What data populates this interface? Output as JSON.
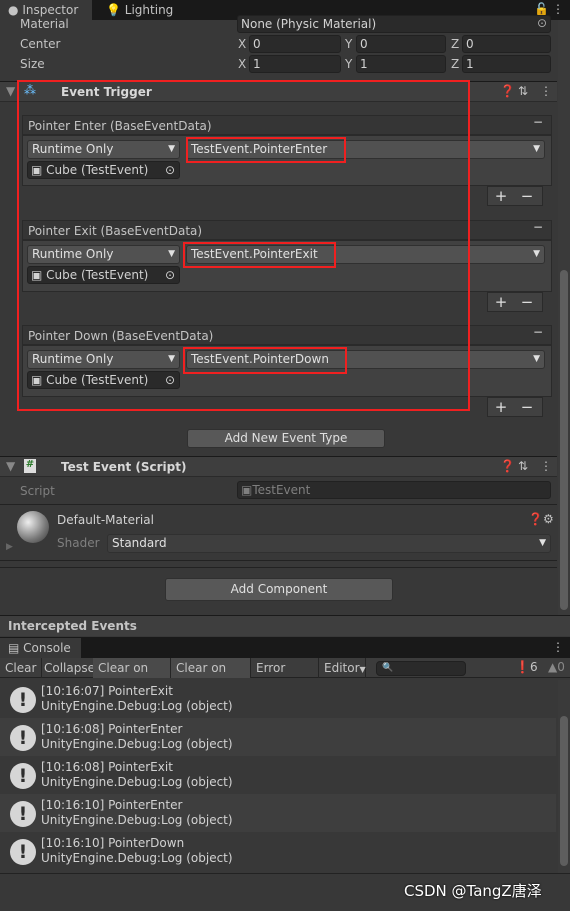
{
  "tabs": {
    "inspector": "Inspector",
    "lighting": "Lighting"
  },
  "collider": {
    "material_label": "Material",
    "material_value": "None (Physic Material)",
    "center_label": "Center",
    "size_label": "Size",
    "center": {
      "x": "0",
      "y": "0",
      "z": "0"
    },
    "size": {
      "x": "1",
      "y": "1",
      "z": "1"
    },
    "axis": {
      "x": "X",
      "y": "Y",
      "z": "Z"
    }
  },
  "event_trigger": {
    "title": "Event Trigger",
    "events": [
      {
        "header": "Pointer Enter (BaseEventData)",
        "mode": "Runtime Only",
        "function": "TestEvent.PointerEnter",
        "target": "Cube (TestEvent)"
      },
      {
        "header": "Pointer Exit (BaseEventData)",
        "mode": "Runtime Only",
        "function": "TestEvent.PointerExit",
        "target": "Cube (TestEvent)"
      },
      {
        "header": "Pointer Down (BaseEventData)",
        "mode": "Runtime Only",
        "function": "TestEvent.PointerDown",
        "target": "Cube (TestEvent)"
      }
    ],
    "add_label": "Add New Event Type",
    "plus": "+",
    "minus": "−"
  },
  "script_component": {
    "title": "Test Event (Script)",
    "script_label": "Script",
    "script_value": "TestEvent"
  },
  "material": {
    "name": "Default-Material",
    "shader_label": "Shader",
    "shader_value": "Standard"
  },
  "add_component": "Add Component",
  "intercepted": "Intercepted Events",
  "console": {
    "tab": "Console",
    "toolbar": [
      "Clear",
      "Collapse",
      "Clear on Play",
      "Clear on Build",
      "Error Pause",
      "Editor"
    ],
    "search_placeholder": "",
    "info_count": "6",
    "warn_count": "0",
    "logs": [
      {
        "line1": "[10:16:07] PointerExit",
        "line2": "UnityEngine.Debug:Log (object)"
      },
      {
        "line1": "[10:16:08] PointerEnter",
        "line2": "UnityEngine.Debug:Log (object)"
      },
      {
        "line1": "[10:16:08] PointerExit",
        "line2": "UnityEngine.Debug:Log (object)"
      },
      {
        "line1": "[10:16:10] PointerEnter",
        "line2": "UnityEngine.Debug:Log (object)"
      },
      {
        "line1": "[10:16:10] PointerDown",
        "line2": "UnityEngine.Debug:Log (object)"
      }
    ]
  },
  "watermark": "CSDN @TangZ唐泽"
}
